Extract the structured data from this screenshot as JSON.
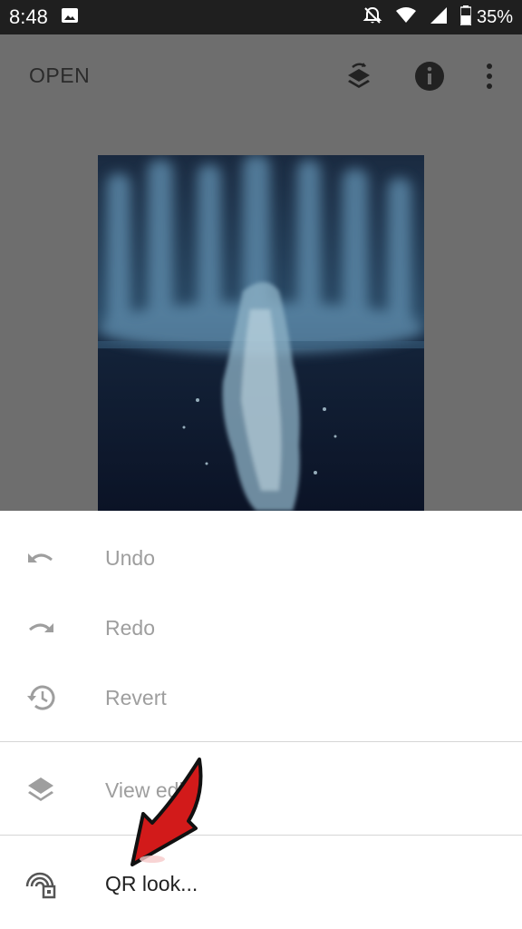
{
  "status_bar": {
    "time": "8:48",
    "battery": "35%",
    "icons": [
      "image-icon",
      "notifications-off-icon",
      "wifi-icon",
      "signal-icon",
      "battery-icon"
    ]
  },
  "app_bar": {
    "open_label": "OPEN",
    "actions": [
      "layers-icon",
      "info-icon",
      "more-vert-icon"
    ]
  },
  "menu": {
    "items": [
      {
        "label": "Undo",
        "icon": "undo-icon"
      },
      {
        "label": "Redo",
        "icon": "redo-icon"
      },
      {
        "label": "Revert",
        "icon": "history-icon"
      },
      {
        "label": "View edits",
        "icon": "layers-icon"
      },
      {
        "label": "QR look...",
        "icon": "qr-look-icon"
      }
    ]
  },
  "colors": {
    "scrim": "#6e6e6e",
    "sheet": "#ffffff",
    "disabled_text": "#9e9e9e",
    "arrow": "#d21a1a"
  }
}
